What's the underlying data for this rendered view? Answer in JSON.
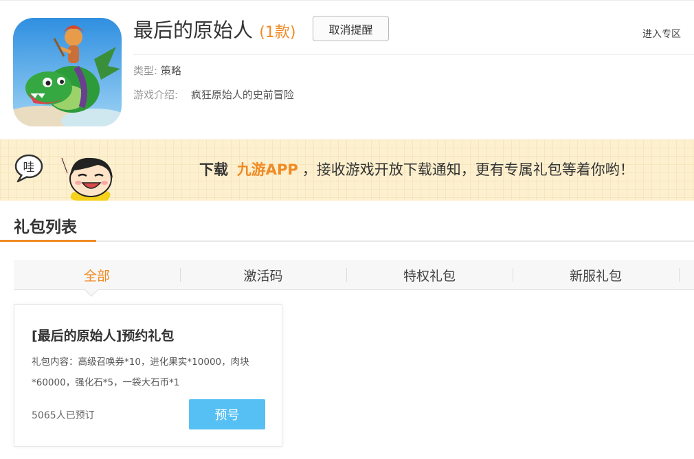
{
  "game": {
    "title": "最后的原始人",
    "count_open": "(",
    "count": "1款",
    "count_close": ")",
    "cancel_reminder_label": "取消提醒",
    "enter_zone_label": "进入专区",
    "type_label": "类型:",
    "type_value": "策略",
    "intro_label": "游戏介绍:",
    "intro_value": "疯狂原始人的史前冒险",
    "icon": "game-app-icon"
  },
  "banner": {
    "bubble_char": "哇",
    "text_download": "下载",
    "text_app": "九游APP",
    "text_rest": "，接收游戏开放下载通知，更有专属礼包等着你哟！"
  },
  "gift_section": {
    "title": "礼包列表",
    "tabs": [
      {
        "label": "全部",
        "active": true
      },
      {
        "label": "激活码",
        "active": false
      },
      {
        "label": "特权礼包",
        "active": false
      },
      {
        "label": "新服礼包",
        "active": false
      }
    ]
  },
  "gifts": [
    {
      "name": "[最后的原始人]预约礼包",
      "content": "礼包内容：高级召唤券*10，进化果实*10000，肉块*60000，强化石*5，一袋大石币*1",
      "reserved_count": "5065人已预订",
      "button_label": "预号"
    }
  ],
  "colors": {
    "accent": "#f08a24",
    "button_blue": "#56c0f4",
    "banner_bg": "#fdf0cf"
  }
}
